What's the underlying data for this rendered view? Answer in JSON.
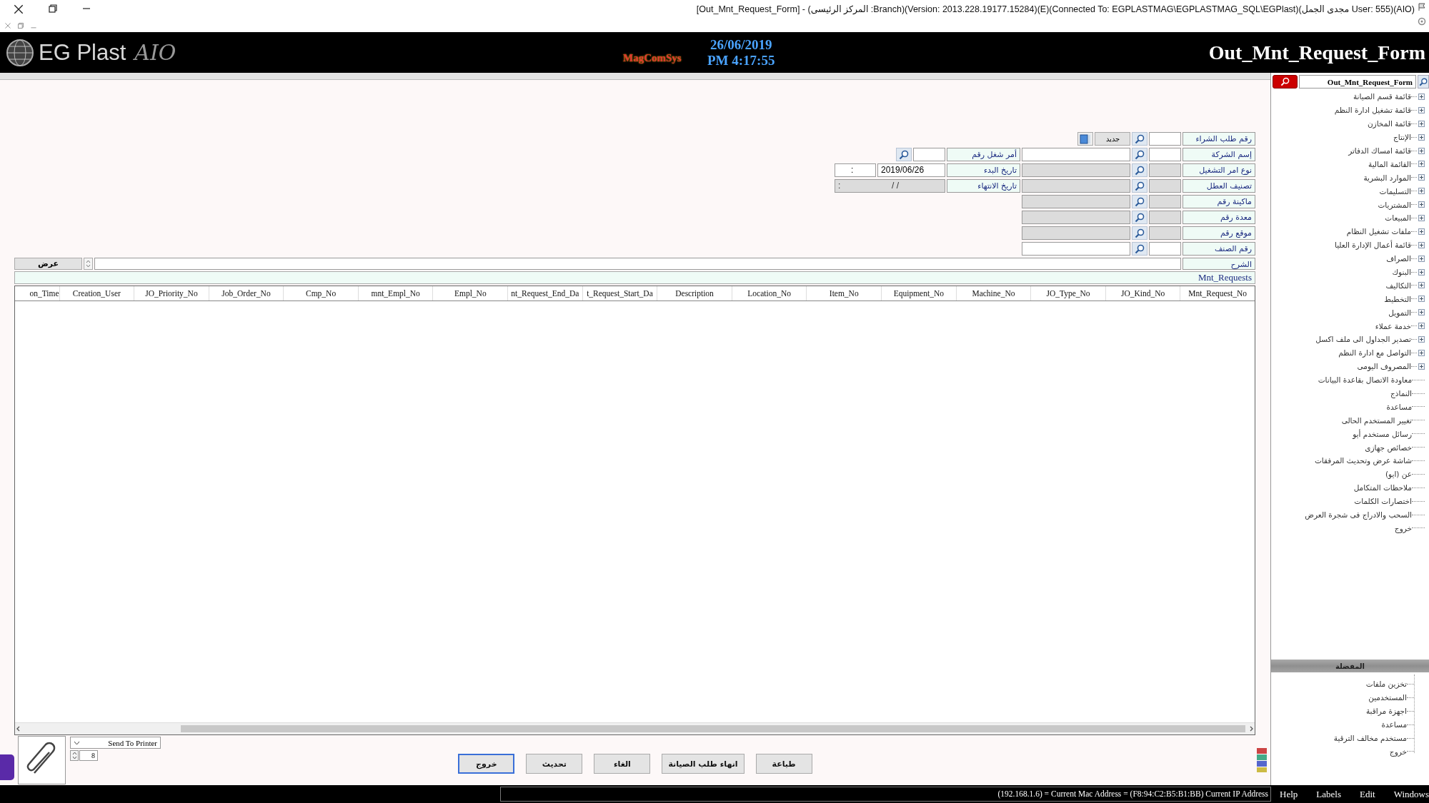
{
  "window": {
    "title": "[Out_Mnt_Request_Form] - (المركز الرئيسى :Branch)(Version: 2013.228.19177.15284)(E)(Connected To: EGPLASTMAG\\EGPLASTMAG_SQL\\EGPlast)(مجدى الجمل User: 555)(AIO)"
  },
  "header": {
    "logo": "EG Plast",
    "logo_suffix": "AIO",
    "brand": "MagComSys",
    "date": "26/06/2019",
    "time": "PM 4:17:55",
    "title": "Out_Mnt_Request_Form"
  },
  "form": {
    "rows": [
      {
        "kind": "new",
        "label": "رقم طلب الشراء",
        "code_disabled": false,
        "button": "جديد"
      },
      {
        "kind": "lookup",
        "label": "إسم الشركة",
        "code_disabled": false,
        "name_disabled": false
      },
      {
        "kind": "lookup",
        "label": "نوع امر التشغيل",
        "code_disabled": true,
        "name_disabled": true
      },
      {
        "kind": "lookup",
        "label": "تصنيف العطل",
        "code_disabled": true,
        "name_disabled": true
      },
      {
        "kind": "lookup",
        "label": "ماكينة رقم",
        "code_disabled": true,
        "name_disabled": true
      },
      {
        "kind": "lookup",
        "label": "معدة رقم",
        "code_disabled": true,
        "name_disabled": true
      },
      {
        "kind": "lookup",
        "label": "موقع رقم",
        "code_disabled": true,
        "name_disabled": true
      },
      {
        "kind": "lookup",
        "label": "رقم الصنف",
        "code_disabled": false,
        "name_disabled": false
      }
    ],
    "side_rows": [
      {
        "kind": "lookup",
        "label": "أمر شغل رقم",
        "code_disabled": false
      },
      {
        "kind": "datetime",
        "label": "تاريخ البدء",
        "date": "2019/06/26",
        "time": ":",
        "disabled": false
      },
      {
        "kind": "datetime",
        "label": "تاريخ الانتهاء",
        "date": "/ /",
        "time": ":",
        "disabled": true
      }
    ],
    "description": {
      "label": "الشرح",
      "button": "عرض"
    }
  },
  "grid": {
    "caption": "Mnt_Requests",
    "columns": [
      "Mnt_Request_No",
      "JO_Kind_No",
      "JO_Type_No",
      "Machine_No",
      "Equipment_No",
      "Item_No",
      "Location_No",
      "Description",
      "t_Request_Start_Da",
      "nt_Request_End_Da",
      "Empl_No",
      "mnt_Empl_No",
      "Cmp_No",
      "Job_Order_No",
      "JO_Priority_No",
      "Creation_User",
      "on_Time"
    ]
  },
  "bottom": {
    "printer": "Send To Printer",
    "copies": "8",
    "buttons": [
      {
        "label": "طباعة",
        "focused": false
      },
      {
        "label": "انهاء طلب الصيانة",
        "focused": false
      },
      {
        "label": "الغاء",
        "focused": false
      },
      {
        "label": "تحديث",
        "focused": false
      },
      {
        "label": "خروج",
        "focused": true
      }
    ]
  },
  "sidebar": {
    "search": {
      "value": "Out_Mnt_Request_Form"
    },
    "tree": [
      {
        "kind": "group",
        "label": "قائمة قسم الصيانة"
      },
      {
        "kind": "group",
        "label": "قائمة تشغيل ادارة النظم"
      },
      {
        "kind": "group",
        "label": "قائمة المخازن"
      },
      {
        "kind": "group",
        "label": "الإنتاج"
      },
      {
        "kind": "group",
        "label": "قائمة امساك الدفاتر"
      },
      {
        "kind": "group",
        "label": "القائمة المالية"
      },
      {
        "kind": "group",
        "label": "الموارد البشرية"
      },
      {
        "kind": "group",
        "label": "التسليمات"
      },
      {
        "kind": "group",
        "label": "المشتريات"
      },
      {
        "kind": "group",
        "label": "المبيعات"
      },
      {
        "kind": "group",
        "label": "ملفات تشغيل النظام"
      },
      {
        "kind": "group",
        "label": "قائمة أعمال الإدارة العليا"
      },
      {
        "kind": "group",
        "label": "الصراف"
      },
      {
        "kind": "group",
        "label": "البنوك"
      },
      {
        "kind": "group",
        "label": "التكاليف"
      },
      {
        "kind": "group",
        "label": "التخطيط"
      },
      {
        "kind": "group",
        "label": "التمويل"
      },
      {
        "kind": "group",
        "label": "خدمة عملاء"
      },
      {
        "kind": "group",
        "label": "تصدير الجداول الى ملف اكسل"
      },
      {
        "kind": "group",
        "label": "التواصل مع ادارة النظم"
      },
      {
        "kind": "group",
        "label": "المصروف اليومى"
      },
      {
        "kind": "item",
        "label": "معاودة الاتصال بقاعدة البيانات"
      },
      {
        "kind": "item",
        "label": "النماذج"
      },
      {
        "kind": "item",
        "label": "مساعدة"
      },
      {
        "kind": "item",
        "label": "تغيير المستخدم الحالى"
      },
      {
        "kind": "item",
        "label": "رسائل مستخدم أيو"
      },
      {
        "kind": "item",
        "label": "خصائص جهازى"
      },
      {
        "kind": "item",
        "label": "شاشة عرض وتحديث المرفقات"
      },
      {
        "kind": "item",
        "label": "عن (ايو)"
      },
      {
        "kind": "item",
        "label": "ملاحظات المتكامل"
      },
      {
        "kind": "item",
        "label": "اختصارات الكلمات"
      },
      {
        "kind": "item",
        "label": "السحب والادراج فى شجرة العرض"
      },
      {
        "kind": "item",
        "label": "خروج"
      }
    ],
    "favorites": {
      "title": "المفضلة",
      "items": [
        "تخزين ملفات",
        "المستخدمين",
        "اجهزة مراقبة",
        "مساعدة",
        "مستخدم مخالف الترقية",
        "خروج"
      ]
    }
  },
  "status_bar": {
    "address": "(192.168.1.6) = Current Mac Address = (F8:94:C2:B5:B1:BB) Current IP Address",
    "menus": [
      "Windows",
      "Edit",
      "Labels",
      "Help"
    ]
  }
}
